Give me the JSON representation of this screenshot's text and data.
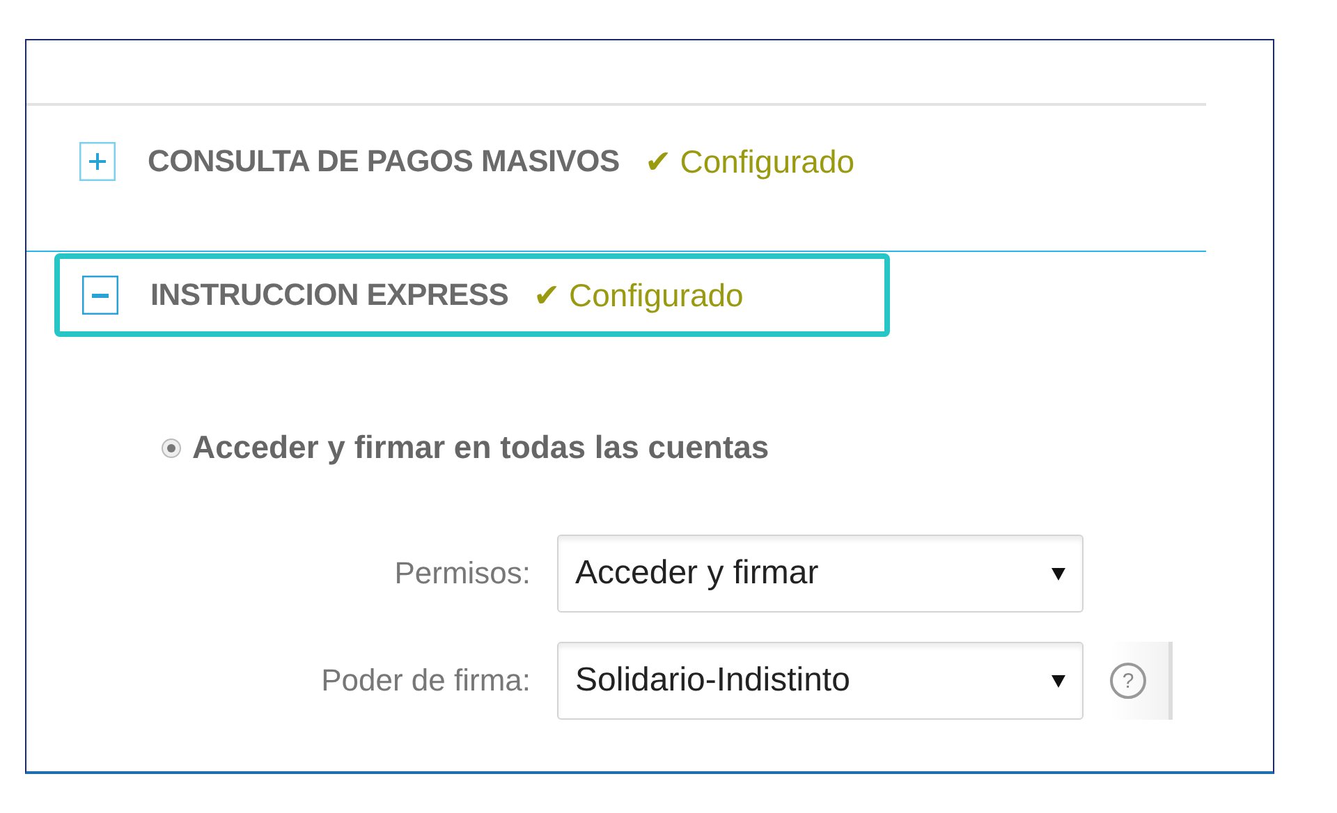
{
  "sections": [
    {
      "title": "CONSULTA DE PAGOS MASIVOS",
      "status": "Configurado",
      "expanded": false,
      "highlighted": false
    },
    {
      "title": "INSTRUCCION EXPRESS",
      "status": "Configurado",
      "expanded": true,
      "highlighted": true,
      "option": {
        "label": "Acceder y firmar en todas las cuentas",
        "selected": true
      },
      "fields": [
        {
          "label": "Permisos:",
          "value": "Acceder y firmar"
        },
        {
          "label": "Poder de firma:",
          "value": "Solidario-Indistinto",
          "help_glyph": "?"
        }
      ]
    }
  ],
  "status_glyph": "✔"
}
